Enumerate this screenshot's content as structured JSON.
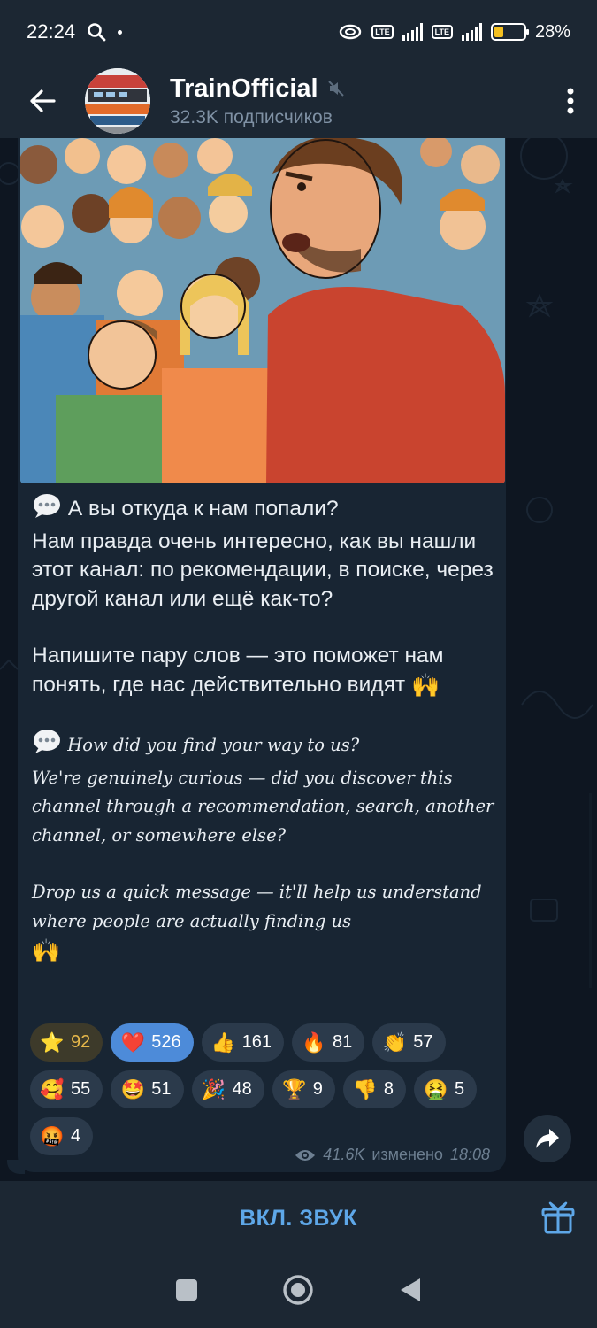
{
  "status_bar": {
    "time": "22:24",
    "battery": "28%"
  },
  "header": {
    "title": "TrainOfficial",
    "subscribers": "32.3K подписчиков"
  },
  "post": {
    "ru_q": "А вы откуда к нам попали?",
    "ru_body": "Нам правда очень интересно, как вы нашли этот канал: по рекомендации, в поиске, через другой канал или ещё как-то?",
    "ru_cta": "Напишите пару слов — это поможет нам понять, где нас действительно видят",
    "en_q": "How did you find your way to us?",
    "en_body": "We're genuinely curious — did you discover this channel through a recommendation, search, another channel, or somewhere else?",
    "en_cta": "Drop us a quick message — it'll help us understand where people are actually finding us"
  },
  "reactions": [
    {
      "icon": "star-icon",
      "glyph": "⭐",
      "count": "92"
    },
    {
      "icon": "heart-icon",
      "glyph": "❤️",
      "count": "526"
    },
    {
      "icon": "thumbs-up-icon",
      "glyph": "👍",
      "count": "161"
    },
    {
      "icon": "fire-icon",
      "glyph": "🔥",
      "count": "81"
    },
    {
      "icon": "clap-icon",
      "glyph": "👏",
      "count": "57"
    },
    {
      "icon": "hearts-face-icon",
      "glyph": "🥰",
      "count": "55"
    },
    {
      "icon": "star-struck-icon",
      "glyph": "🤩",
      "count": "51"
    },
    {
      "icon": "party-popper-icon",
      "glyph": "🎉",
      "count": "48"
    },
    {
      "icon": "trophy-icon",
      "glyph": "🏆",
      "count": "9"
    },
    {
      "icon": "thumbs-down-icon",
      "glyph": "👎",
      "count": "8"
    },
    {
      "icon": "vomit-face-icon",
      "glyph": "🤮",
      "count": "5"
    },
    {
      "icon": "cursing-face-icon",
      "glyph": "🤬",
      "count": "4"
    }
  ],
  "meta": {
    "views": "41.6K",
    "edited": "изменено",
    "time": "18:08"
  },
  "bottom": {
    "unmute": "ВКЛ. ЗВУК"
  }
}
